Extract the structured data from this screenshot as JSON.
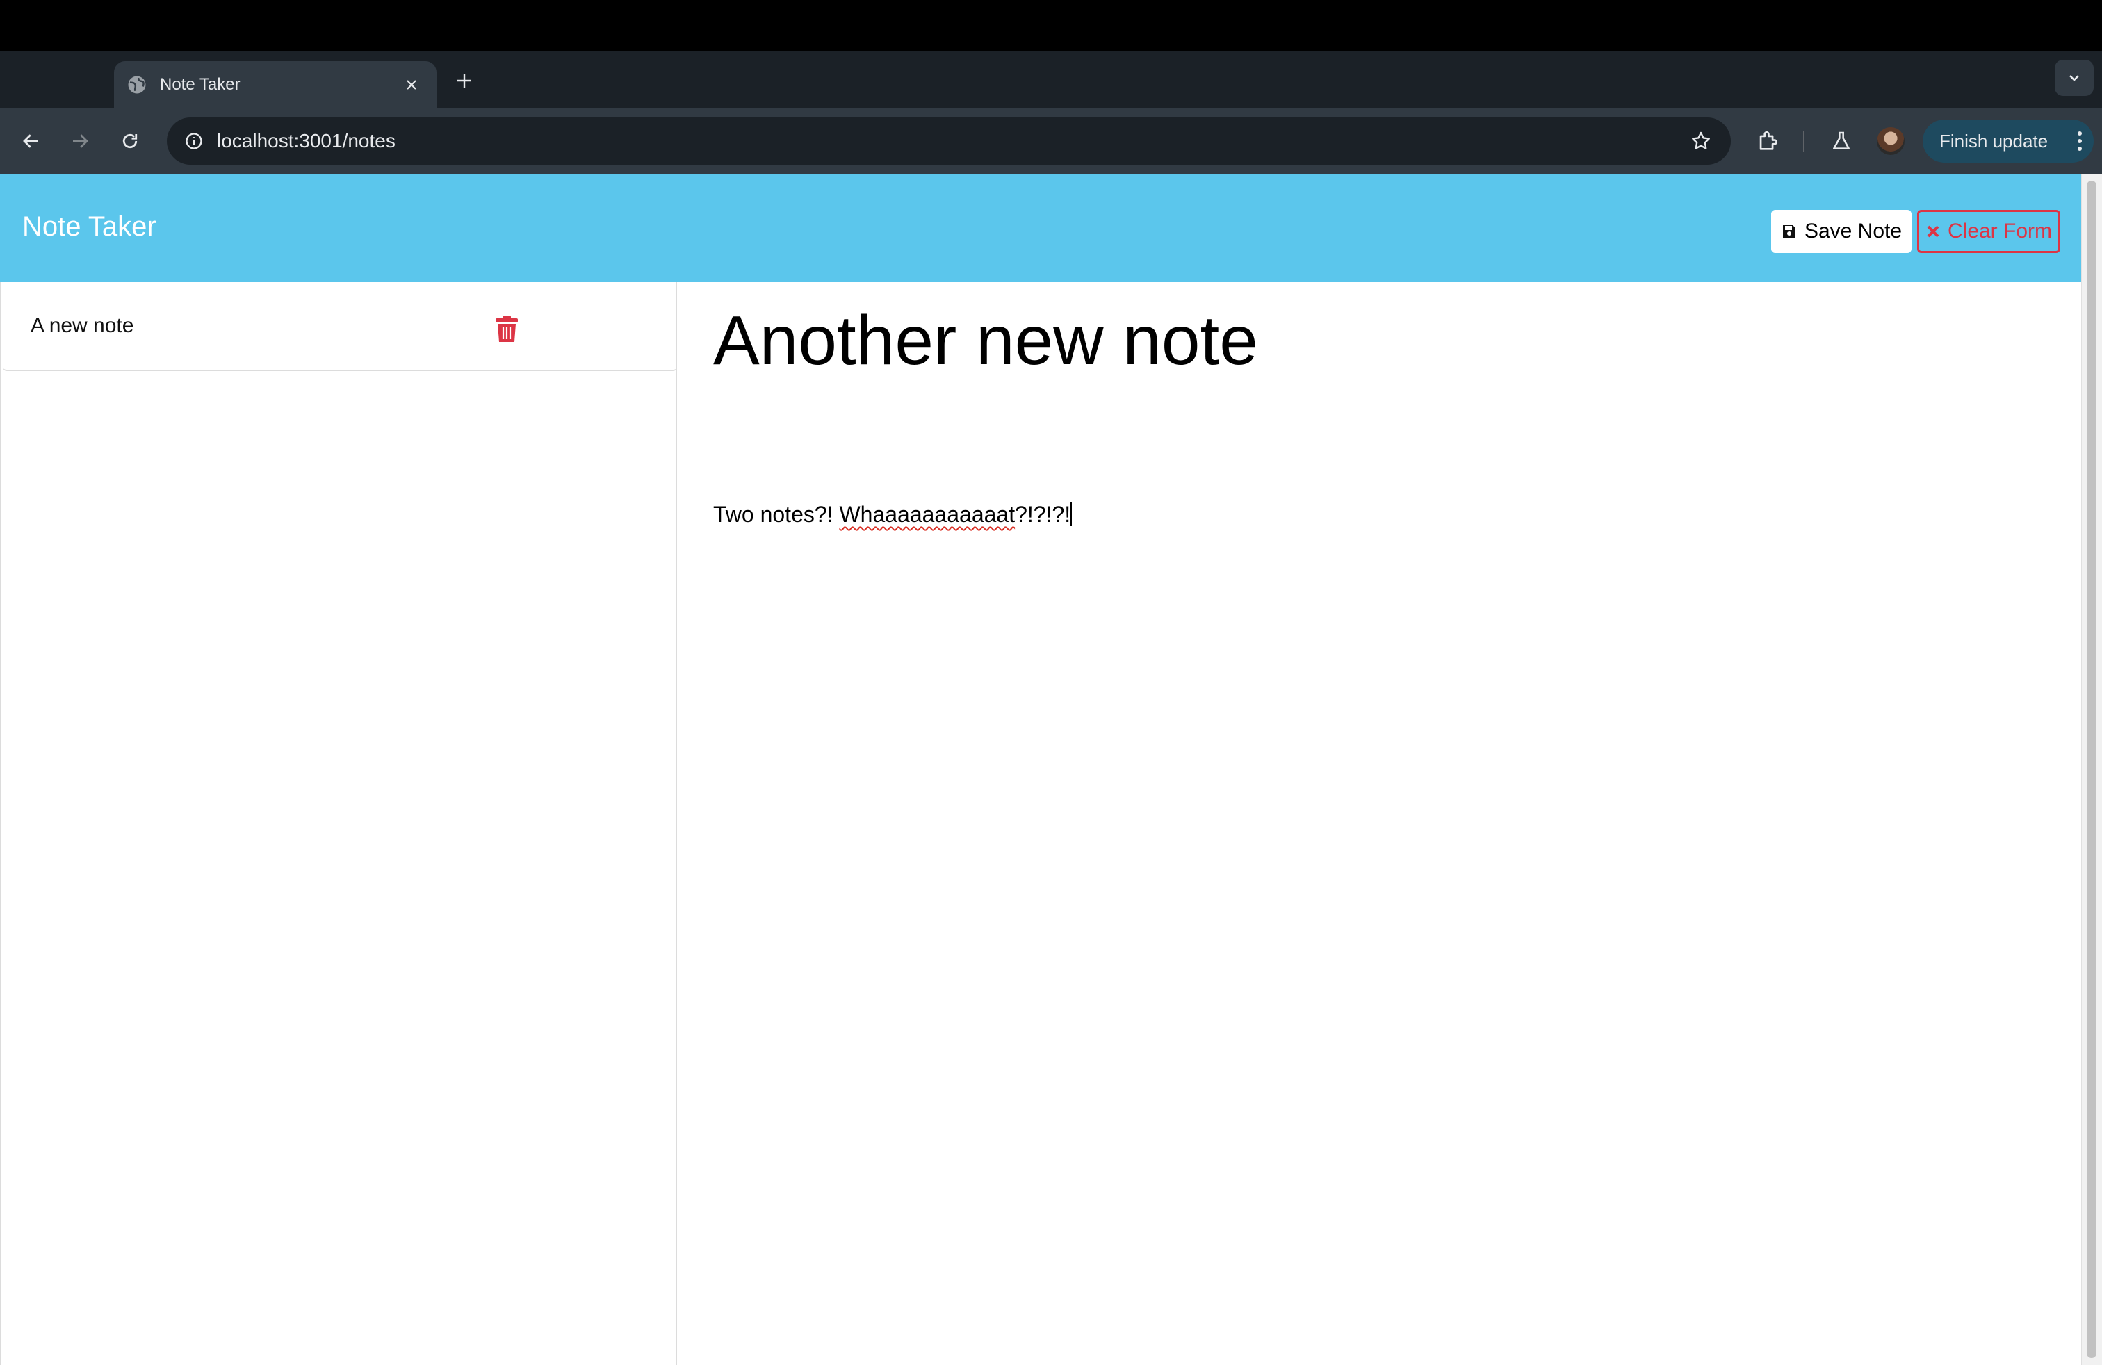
{
  "browser": {
    "tab": {
      "title": "Note Taker",
      "icon": "globe-icon"
    },
    "address_bar": {
      "url": "localhost:3001/notes"
    },
    "finish_update_label": "Finish update"
  },
  "app": {
    "brand": "Note Taker",
    "actions": {
      "save_label": "Save Note",
      "clear_label": "Clear Form"
    },
    "colors": {
      "header": "#5bc6ec",
      "danger": "#dc3545"
    }
  },
  "sidebar": {
    "notes": [
      {
        "title": "A new note"
      }
    ]
  },
  "editor": {
    "title": "Another new note",
    "body_prefix": "Two notes?! ",
    "body_misspelled": "Whaaaaaaaaaaat",
    "body_suffix": "?!?!?!"
  }
}
